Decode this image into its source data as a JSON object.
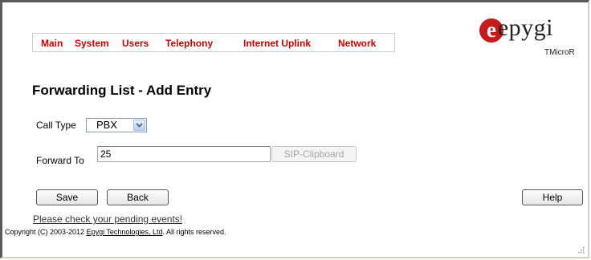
{
  "nav": {
    "items": [
      "Main",
      "System",
      "Users",
      "Telephony",
      "Internet Uplink",
      "Network"
    ]
  },
  "logo": {
    "brand": "epygi",
    "letter": "e",
    "product": "TMicroR",
    "brand_color": "#c8191d"
  },
  "page": {
    "title": "Forwarding List - Add Entry"
  },
  "form": {
    "call_type_label": "Call Type",
    "call_type_value": "PBX",
    "forward_to_label": "Forward To",
    "forward_to_value": "25",
    "sip_clipboard_label": "SIP-Clipboard"
  },
  "buttons": {
    "save": "Save",
    "back": "Back",
    "help": "Help"
  },
  "footer": {
    "pending_link": "Please check your pending events!",
    "copyright_prefix": "Copyright (C) 2003-2012 ",
    "company_link": "Epygi Technologies, Ltd",
    "copyright_suffix": ". All rights reserved."
  },
  "colors": {
    "menu_text": "#cc0000"
  }
}
